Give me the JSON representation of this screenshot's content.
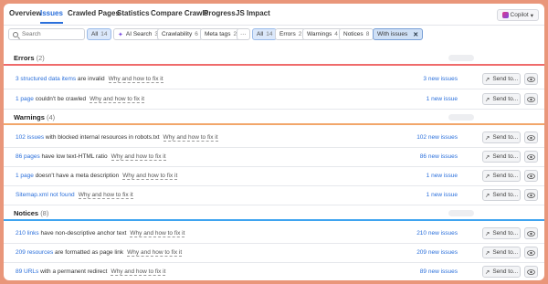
{
  "tabs": [
    {
      "label": "Overview"
    },
    {
      "label": "Issues"
    },
    {
      "label": "Crawled Pages"
    },
    {
      "label": "Statistics"
    },
    {
      "label": "Compare Crawls"
    },
    {
      "label": "Progress"
    },
    {
      "label": "JS Impact"
    }
  ],
  "copilot": {
    "label": "Copilot"
  },
  "search": {
    "placeholder": "Search",
    "value": ""
  },
  "category_filters": [
    {
      "label": "All",
      "count": "14"
    },
    {
      "label": "AI Search",
      "count": "3"
    },
    {
      "label": "Crawlability",
      "count": "6"
    },
    {
      "label": "Meta tags",
      "count": "2"
    },
    {
      "label": "···",
      "count": ""
    }
  ],
  "type_filters": [
    {
      "label": "All",
      "count": "14"
    },
    {
      "label": "Errors",
      "count": "2"
    },
    {
      "label": "Warnings",
      "count": "4"
    },
    {
      "label": "Notices",
      "count": "8"
    }
  ],
  "with_issues": {
    "label": "With issues",
    "close": "✕"
  },
  "send_label": "Send to...",
  "why_label": "Why and how to fix it",
  "colors": {
    "errors": "#ef6b6b",
    "warnings": "#f2a66a",
    "notices": "#3fa4f0",
    "link": "#2a6fdb"
  },
  "sections": {
    "errors": {
      "title": "Errors",
      "count": "(2)",
      "rows": [
        {
          "link": "3 structured data items",
          "text": " are invalid",
          "new_issues": "3 new issues"
        },
        {
          "link": "1 page",
          "text": " couldn't be crawled",
          "new_issues": "1 new issue"
        }
      ]
    },
    "warnings": {
      "title": "Warnings",
      "count": "(4)",
      "rows": [
        {
          "link": "102 issues",
          "text": " with blocked internal resources in robots.txt",
          "new_issues": "102 new issues"
        },
        {
          "link": "86 pages",
          "text": " have low text-HTML ratio",
          "new_issues": "86 new issues"
        },
        {
          "link": "1 page",
          "text": " doesn't have a meta description",
          "new_issues": "1 new issue"
        },
        {
          "link": "Sitemap.xml not found",
          "text": "",
          "new_issues": "1 new issue"
        }
      ]
    },
    "notices": {
      "title": "Notices",
      "count": "(8)",
      "rows": [
        {
          "link": "210 links",
          "text": " have non-descriptive anchor text",
          "new_issues": "210 new issues"
        },
        {
          "link": "209 resources",
          "text": " are formatted as page link",
          "new_issues": "209 new issues"
        },
        {
          "link": "89 URLs",
          "text": " with a permanent redirect",
          "new_issues": "89 new issues"
        }
      ]
    }
  }
}
